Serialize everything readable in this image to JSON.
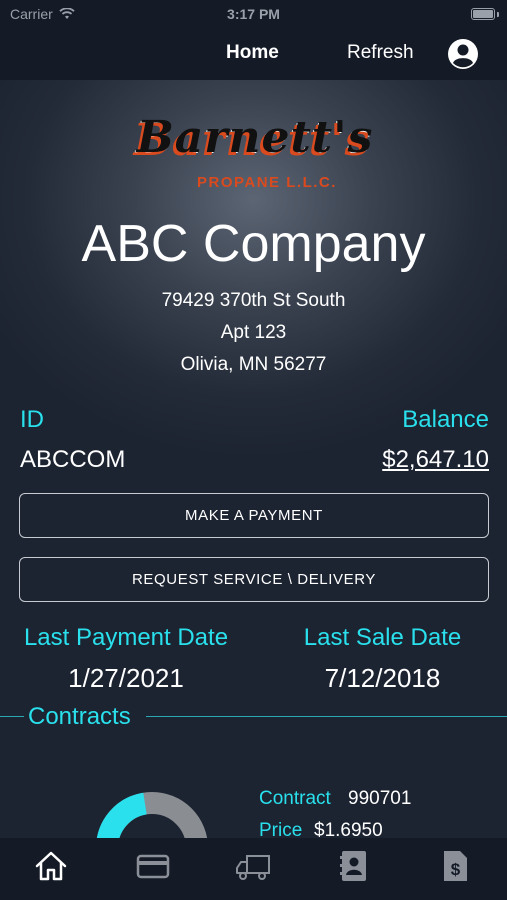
{
  "status_bar": {
    "carrier": "Carrier",
    "time": "3:17 PM"
  },
  "nav": {
    "home": "Home",
    "refresh": "Refresh"
  },
  "logo": {
    "script": "Barnett's",
    "sub": "PROPANE L.L.C."
  },
  "company": {
    "name": "ABC Company",
    "address_line1": "79429 370th St South",
    "address_line2": "Apt 123",
    "address_line3": "Olivia, MN 56277"
  },
  "account": {
    "id_label": "ID",
    "id_value": "ABCCOM",
    "balance_label": "Balance",
    "balance_value": "$2,647.10"
  },
  "buttons": {
    "make_payment": "MAKE A PAYMENT",
    "request_service": "REQUEST SERVICE \\ DELIVERY"
  },
  "dates": {
    "last_payment_label": "Last Payment Date",
    "last_payment_value": "1/27/2021",
    "last_sale_label": "Last Sale Date",
    "last_sale_value": "7/12/2018"
  },
  "contracts": {
    "section_label": "Contracts",
    "contract_label": "Contract",
    "contract_value": "990701",
    "price_label": "Price",
    "price_value": "$1.6950",
    "gauge_fill_fraction": 0.45
  },
  "colors": {
    "accent": "#29e0ec",
    "background": "#1b2230",
    "bar": "#151b26",
    "gauge_empty": "#8a8d92"
  },
  "tabs": [
    {
      "icon": "home-icon",
      "active": true
    },
    {
      "icon": "credit-card-icon",
      "active": false
    },
    {
      "icon": "delivery-truck-icon",
      "active": false
    },
    {
      "icon": "contact-card-icon",
      "active": false
    },
    {
      "icon": "invoice-dollar-icon",
      "active": false
    }
  ]
}
